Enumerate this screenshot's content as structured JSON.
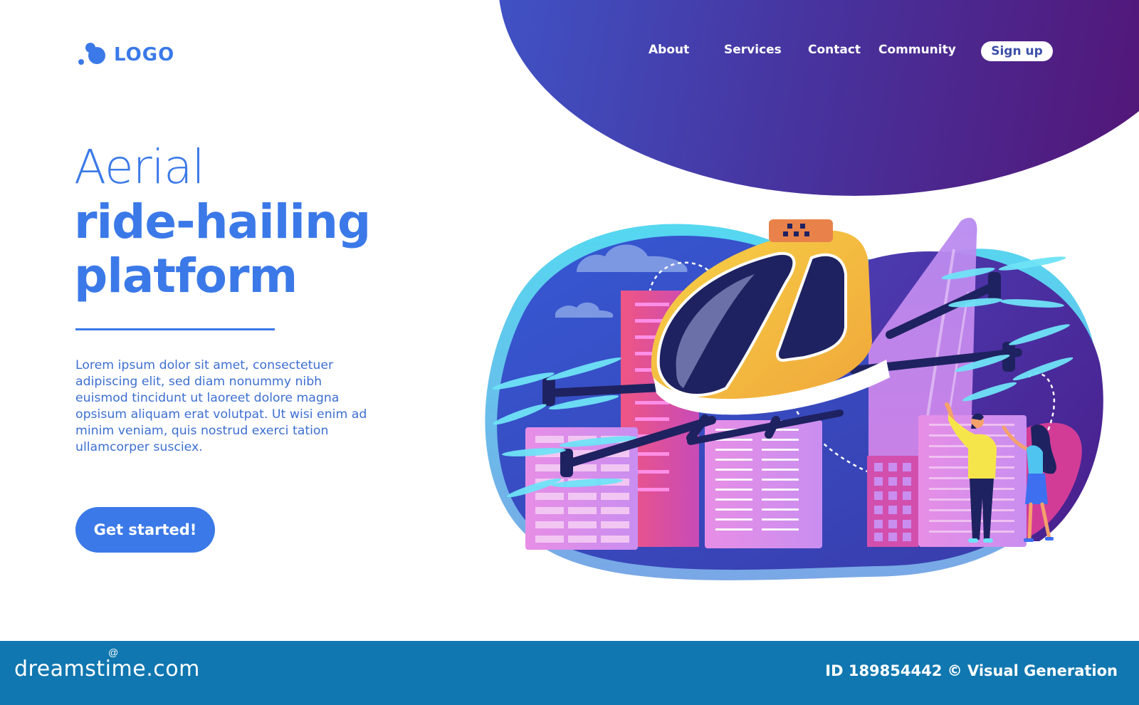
{
  "logo": {
    "text": "LOGO",
    "icon": "bubbles-logo-icon"
  },
  "nav": {
    "items": [
      {
        "label": "About"
      },
      {
        "label": "Services"
      },
      {
        "label": "Contact"
      },
      {
        "label": "Community"
      }
    ],
    "signup_label": "Sign up"
  },
  "hero": {
    "title_light": "Aerial",
    "title_bold_line1": "ride-hailing",
    "title_bold_line2": "platform",
    "body": "Lorem ipsum dolor sit amet, consectetuer adipiscing elit, sed diam nonummy nibh euismod tincidunt ut laoreet dolore magna opsisum aliquam erat volutpat. Ut wisi enim ad minim veniam, quis nostrud exerci tation ullamcorper susciex.",
    "cta_label": "Get started!"
  },
  "illustration": {
    "subject": "air-taxi-drone-over-city",
    "taxi_sign_icon": "taxi-checker-icon"
  },
  "colors": {
    "accent": "#3b79e8",
    "nav_gradient_start": "#3f56c9",
    "nav_gradient_end": "#551070",
    "footer": "#1077b0",
    "taxi_yellow": "#f6c23b",
    "taxi_orange": "#e8824a",
    "propeller": "#6fe3f7",
    "building_pink": "#e95f9a"
  },
  "footer": {
    "brand": "dreamstime.com",
    "credit": "ID 189854442 © Visual Generation"
  }
}
